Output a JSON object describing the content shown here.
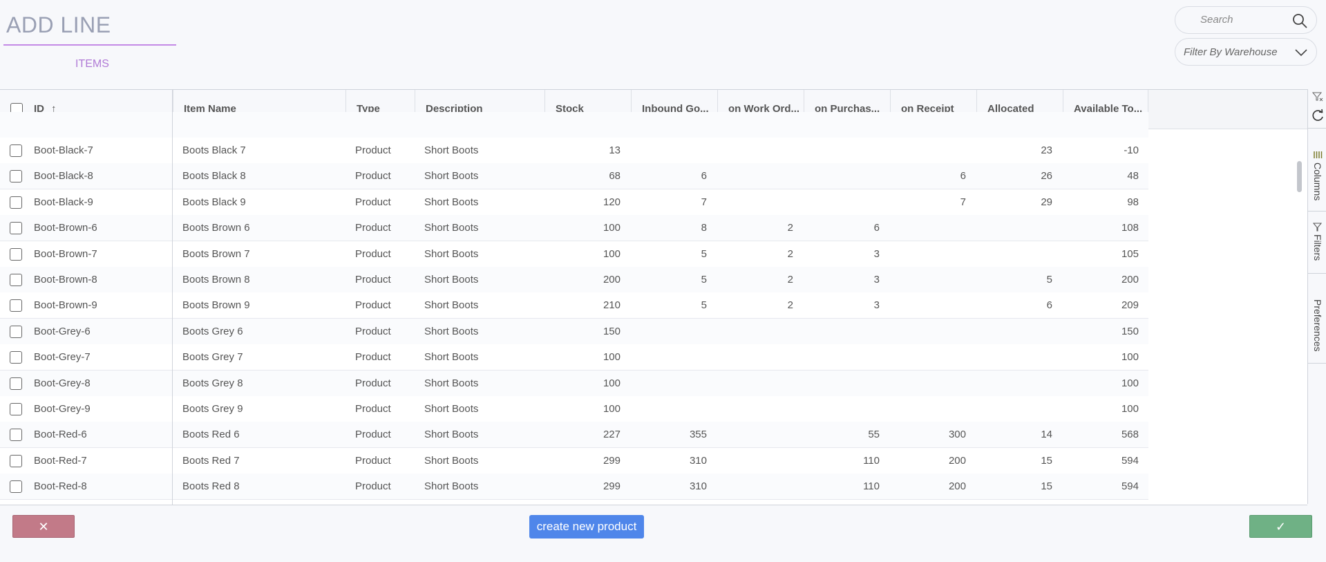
{
  "header": {
    "title": "ADD LINE",
    "subtab": "ITEMS",
    "search_placeholder": "Search",
    "warehouse_filter": "Filter By Warehouse"
  },
  "grid": {
    "columns": [
      "ID",
      "Item Name",
      "Type",
      "Description",
      "Stock",
      "Inbound Go...",
      "on Work Ord...",
      "on Purchas...",
      "on Receipt",
      "Allocated",
      "Available To..."
    ],
    "sort_indicator": "↑",
    "rows": [
      [
        "Boot-Black-7",
        "Boots Black 7",
        "Product",
        "Short Boots",
        "13",
        "",
        "",
        "",
        "",
        "23",
        "-10"
      ],
      [
        "Boot-Black-8",
        "Boots Black 8",
        "Product",
        "Short Boots",
        "68",
        "6",
        "",
        "",
        "6",
        "26",
        "48"
      ],
      [
        "Boot-Black-9",
        "Boots Black 9",
        "Product",
        "Short Boots",
        "120",
        "7",
        "",
        "",
        "7",
        "29",
        "98"
      ],
      [
        "Boot-Brown-6",
        "Boots Brown 6",
        "Product",
        "Short Boots",
        "100",
        "8",
        "2",
        "6",
        "",
        "",
        "108"
      ],
      [
        "Boot-Brown-7",
        "Boots Brown 7",
        "Product",
        "Short Boots",
        "100",
        "5",
        "2",
        "3",
        "",
        "",
        "105"
      ],
      [
        "Boot-Brown-8",
        "Boots Brown 8",
        "Product",
        "Short Boots",
        "200",
        "5",
        "2",
        "3",
        "",
        "5",
        "200"
      ],
      [
        "Boot-Brown-9",
        "Boots Brown 9",
        "Product",
        "Short Boots",
        "210",
        "5",
        "2",
        "3",
        "",
        "6",
        "209"
      ],
      [
        "Boot-Grey-6",
        "Boots Grey 6",
        "Product",
        "Short Boots",
        "150",
        "",
        "",
        "",
        "",
        "",
        "150"
      ],
      [
        "Boot-Grey-7",
        "Boots Grey 7",
        "Product",
        "Short Boots",
        "100",
        "",
        "",
        "",
        "",
        "",
        "100"
      ],
      [
        "Boot-Grey-8",
        "Boots Grey 8",
        "Product",
        "Short Boots",
        "100",
        "",
        "",
        "",
        "",
        "",
        "100"
      ],
      [
        "Boot-Grey-9",
        "Boots Grey 9",
        "Product",
        "Short Boots",
        "100",
        "",
        "",
        "",
        "",
        "",
        "100"
      ],
      [
        "Boot-Red-6",
        "Boots Red 6",
        "Product",
        "Short Boots",
        "227",
        "355",
        "",
        "55",
        "300",
        "14",
        "568"
      ],
      [
        "Boot-Red-7",
        "Boots Red 7",
        "Product",
        "Short Boots",
        "299",
        "310",
        "",
        "110",
        "200",
        "15",
        "594"
      ],
      [
        "Boot-Red-8",
        "Boots Red 8",
        "Product",
        "Short Boots",
        "299",
        "310",
        "",
        "110",
        "200",
        "15",
        "594"
      ]
    ]
  },
  "side_panel": {
    "columns": "Columns",
    "filters": "Filters",
    "preferences": "Preferences"
  },
  "footer": {
    "cancel": "✕",
    "create": "create new product",
    "confirm": "✓"
  },
  "colors": {
    "accent": "#b07ad6",
    "cancel": "#c27a88",
    "create": "#4f86ea",
    "confirm": "#6fb185"
  }
}
